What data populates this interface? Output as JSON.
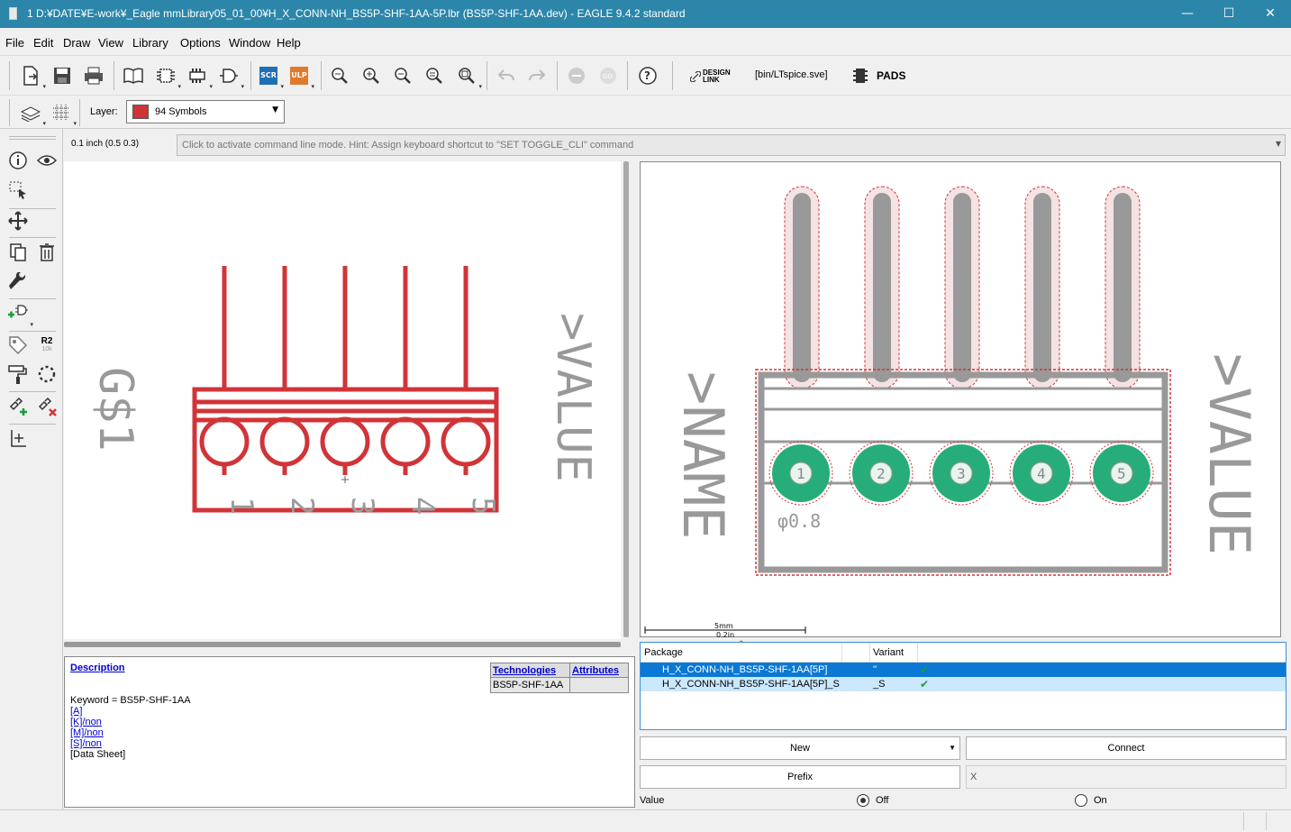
{
  "window": {
    "title": "1 D:¥DATE¥E-work¥_Eagle mmLibrary05_01_00¥H_X_CONN-NH_BS5P-SHF-1AA-5P.lbr (BS5P-SHF-1AA.dev) - EAGLE 9.4.2 standard",
    "minimize": "—",
    "maximize": "☐",
    "close": "✕"
  },
  "menu": [
    "File",
    "Edit",
    "Draw",
    "View",
    "Library",
    "Options",
    "Window",
    "Help"
  ],
  "toolbar": {
    "scr": "SCR",
    "ulp": "ULP",
    "design_link": "DESIGN LINK",
    "ulp_path": "[bin/LTspice.sve]",
    "pads": "PADS"
  },
  "layer": {
    "label": "Layer:",
    "selected": "94 Symbols",
    "color": "#d13438"
  },
  "coordbar": {
    "grid": "0.1 inch (0.5 0.3)",
    "cli_hint": "Click to activate command line mode. Hint: Assign keyboard shortcut to \"SET TOGGLE_CLI\" command"
  },
  "lefttool": {
    "r2": "R2",
    "r2sub": "10k"
  },
  "schematic": {
    "name_text": "G$1",
    "value_text": ">VALUE",
    "pins": [
      "1",
      "2",
      "3",
      "4",
      "5"
    ]
  },
  "package_view": {
    "name_text": ">NAME",
    "value_text": ">VALUE",
    "drill": "φ0.8",
    "pads": [
      "1",
      "2",
      "3",
      "4",
      "5"
    ],
    "scale_top": "5mm",
    "scale_bottom": "0.2in"
  },
  "description": {
    "heading": "Description",
    "keyword": "Keyword = BS5P-SHF-1AA",
    "links": [
      "[A]",
      "[K]/non",
      "[M]/non",
      "[S]/non"
    ],
    "datasheet": "[Data Sheet]",
    "tech_header": "Technologies",
    "attr_header": "Attributes",
    "tech_value": "BS5P-SHF-1AA"
  },
  "packages": {
    "col_package": "Package",
    "col_variant": "Variant",
    "rows": [
      {
        "package": "H_X_CONN-NH_BS5P-SHF-1AA[5P]",
        "variant": "''",
        "check": "✔"
      },
      {
        "package": "H_X_CONN-NH_BS5P-SHF-1AA[5P]_S",
        "variant": "_S",
        "check": "✔"
      }
    ]
  },
  "buttons": {
    "new": "New",
    "connect": "Connect",
    "prefix": "Prefix",
    "prefix_value": "X"
  },
  "value": {
    "label": "Value",
    "off": "Off",
    "on": "On"
  }
}
